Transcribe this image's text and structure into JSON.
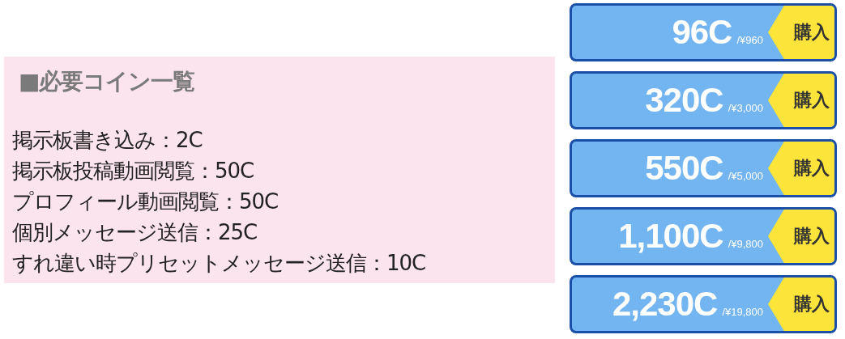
{
  "coin_list": {
    "title": "■必要コイン一覧",
    "items": [
      "掲示板書き込み：2C",
      "掲示板投稿動画閲覧：50C",
      "プロフィール動画閲覧：50C",
      "個別メッセージ送信：25C",
      "すれ違い時プリセットメッセージ送信：10C"
    ]
  },
  "packages": [
    {
      "coins": "96C",
      "price": "/¥960",
      "action": "購入"
    },
    {
      "coins": "320C",
      "price": "/¥3,000",
      "action": "購入"
    },
    {
      "coins": "550C",
      "price": "/¥5,000",
      "action": "購入"
    },
    {
      "coins": "1,100C",
      "price": "/¥9,800",
      "action": "購入"
    },
    {
      "coins": "2,230C",
      "price": "/¥19,800",
      "action": "購入"
    }
  ]
}
